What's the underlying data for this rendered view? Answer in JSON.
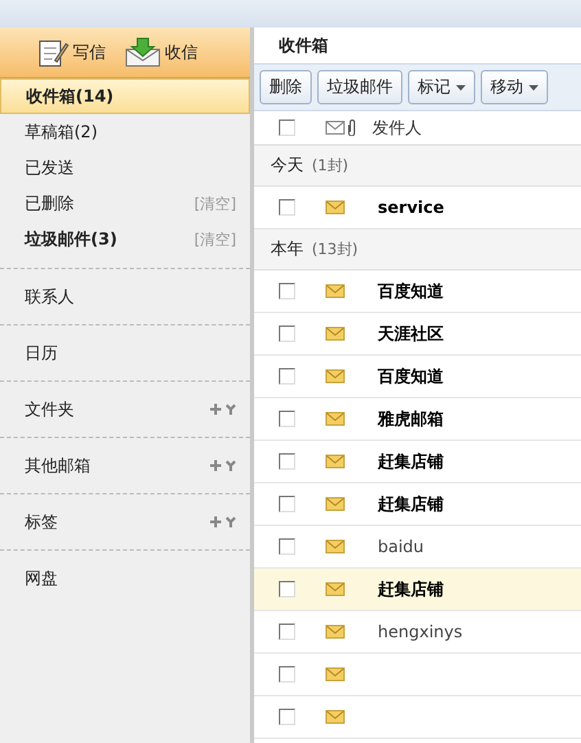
{
  "sidebar": {
    "actions": [
      {
        "kind": "compose",
        "label": "写信"
      },
      {
        "kind": "receive",
        "label": "收信"
      }
    ],
    "folders": [
      {
        "label": "收件箱(14)",
        "selected": true,
        "bold": true
      },
      {
        "label": "草稿箱(2)",
        "selected": false,
        "bold": false
      },
      {
        "label": "已发送",
        "selected": false,
        "bold": false
      },
      {
        "label": "已删除",
        "selected": false,
        "bold": false,
        "action": "[清空]"
      },
      {
        "label": "垃圾邮件(3)",
        "selected": false,
        "bold": true,
        "action": "[清空]"
      }
    ],
    "sections": [
      {
        "label": "联系人",
        "tools": false
      },
      {
        "label": "日历",
        "tools": false
      },
      {
        "label": "文件夹",
        "tools": true
      },
      {
        "label": "其他邮箱",
        "tools": true
      },
      {
        "label": "标签",
        "tools": true
      },
      {
        "label": "网盘",
        "tools": false
      }
    ]
  },
  "main": {
    "title": "收件箱",
    "toolbar": [
      {
        "label": "删除",
        "dropdown": false
      },
      {
        "label": "垃圾邮件",
        "dropdown": false
      },
      {
        "label": "标记",
        "dropdown": true
      },
      {
        "label": "移动",
        "dropdown": true
      }
    ],
    "columns": {
      "sender": "发件人",
      "all_checked": false
    },
    "groups": [
      {
        "label": "今天",
        "count": "(1封)",
        "messages": [
          {
            "sender": "service",
            "unread": true,
            "selected": false
          }
        ]
      },
      {
        "label": "本年",
        "count": "(13封)",
        "messages": [
          {
            "sender": "百度知道",
            "unread": true,
            "selected": false
          },
          {
            "sender": "天涯社区",
            "unread": true,
            "selected": false
          },
          {
            "sender": "百度知道",
            "unread": true,
            "selected": false
          },
          {
            "sender": "雅虎邮箱",
            "unread": true,
            "selected": false
          },
          {
            "sender": "赶集店铺",
            "unread": true,
            "selected": false
          },
          {
            "sender": "赶集店铺",
            "unread": true,
            "selected": false
          },
          {
            "sender": "baidu",
            "unread": false,
            "selected": false
          },
          {
            "sender": "赶集店铺",
            "unread": true,
            "selected": true
          },
          {
            "sender": "hengxinys",
            "unread": false,
            "selected": false
          },
          {
            "selected": false
          },
          {
            "selected": false
          }
        ]
      }
    ]
  }
}
